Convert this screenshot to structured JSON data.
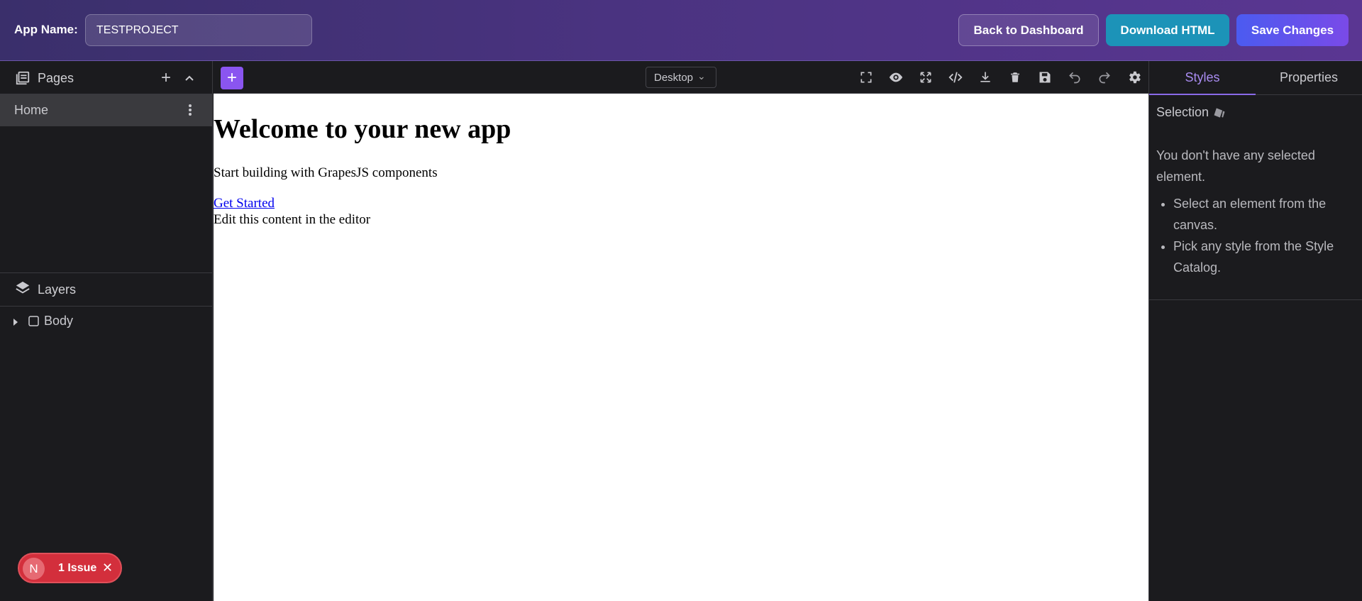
{
  "header": {
    "app_name_label": "App Name:",
    "app_name_value": "TESTPROJECT",
    "back_label": "Back to Dashboard",
    "download_label": "Download HTML",
    "save_label": "Save Changes"
  },
  "left_panel": {
    "pages_title": "Pages",
    "pages": [
      {
        "label": "Home"
      }
    ],
    "layers_title": "Layers",
    "layers": [
      {
        "label": "Body"
      }
    ]
  },
  "issue_badge": {
    "avatar_letter": "N",
    "text": "1 Issue"
  },
  "toolbar": {
    "device": "Desktop",
    "icons": [
      "fullscreen-icon",
      "preview-icon",
      "expand-icon",
      "code-icon",
      "download-icon",
      "delete-icon",
      "save-icon",
      "undo-icon",
      "redo-icon",
      "settings-icon"
    ]
  },
  "canvas": {
    "heading": "Welcome to your new app",
    "subtitle": "Start building with GrapesJS components",
    "link": "Get Started",
    "note": "Edit this content in the editor"
  },
  "right_panel": {
    "tabs": [
      {
        "label": "Styles",
        "active": true
      },
      {
        "label": "Properties",
        "active": false
      }
    ],
    "selection_label": "Selection",
    "message": "You don't have any selected element.",
    "hints": [
      "Select an element from the canvas.",
      "Pick any style from the Style Catalog."
    ]
  },
  "colors": {
    "accent": "#8a55f0",
    "download": "#1c93b8",
    "issue": "#d32f3c"
  }
}
